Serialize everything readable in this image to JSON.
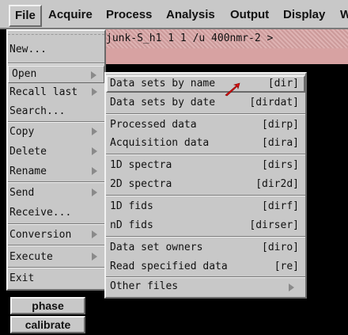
{
  "menubar": {
    "items": [
      "File",
      "Acquire",
      "Process",
      "Analysis",
      "Output",
      "Display",
      "W"
    ]
  },
  "title_strip": {
    "text": "junk-S_h1 1 1 /u 400nmr-2 >"
  },
  "file_menu": {
    "items": [
      {
        "label": "New..."
      },
      {
        "label": "Open"
      },
      {
        "label": "Recall last"
      },
      {
        "label": "Search..."
      },
      {
        "label": "Copy"
      },
      {
        "label": "Delete"
      },
      {
        "label": "Rename"
      },
      {
        "label": "Send"
      },
      {
        "label": "Receive..."
      },
      {
        "label": "Conversion"
      },
      {
        "label": "Execute"
      },
      {
        "label": "Exit"
      }
    ]
  },
  "open_submenu": {
    "items": [
      {
        "label": "Data sets by name",
        "code": "[dir]"
      },
      {
        "label": "Data sets by date",
        "code": "[dirdat]"
      },
      {
        "label": "Processed data",
        "code": "[dirp]"
      },
      {
        "label": "Acquisition data",
        "code": "[dira]"
      },
      {
        "label": "1D spectra",
        "code": "[dirs]"
      },
      {
        "label": "2D spectra",
        "code": "[dir2d]"
      },
      {
        "label": "1D fids",
        "code": "[dirf]"
      },
      {
        "label": "nD fids",
        "code": "[dirser]"
      },
      {
        "label": "Data set owners",
        "code": "[diro]"
      },
      {
        "label": "Read specified data",
        "code": "[re]"
      },
      {
        "label": "Other files",
        "code": ""
      }
    ]
  },
  "side_buttons": {
    "phase": "phase",
    "calibrate": "calibrate"
  },
  "colors": {
    "menu_bg": "#c8c8c8",
    "title_strip_bg": "#d7a2a2",
    "workspace_bg": "#000000",
    "cursor": "#e01010"
  }
}
